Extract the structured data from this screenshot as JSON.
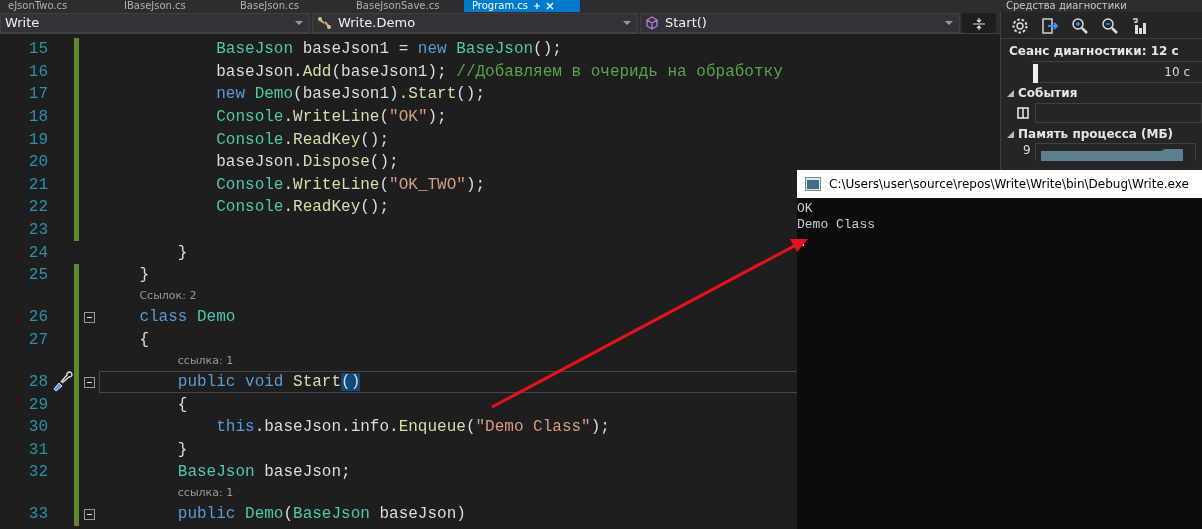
{
  "editor_tabs": [
    {
      "label": "eJsonTwo.cs",
      "selected": false
    },
    {
      "label": "IBaseJson.cs",
      "selected": false
    },
    {
      "label": "BaseJson.cs",
      "selected": false
    },
    {
      "label": "BaseJsonSave.cs",
      "selected": false
    },
    {
      "label": "Program.cs",
      "selected": true
    }
  ],
  "diagnostics_title": "Средства диагностики",
  "navigation": {
    "project": "Write",
    "type": "Write.Demo",
    "member": "Start()"
  },
  "code_lines": [
    {
      "kind": "statement",
      "number": "15",
      "changed": true,
      "foldable": false,
      "current": false,
      "quick_actions": false,
      "tokens": [
        {
          "kind": "t",
          "text": "BaseJson"
        },
        {
          "kind": "p",
          "text": " baseJson1 = "
        },
        {
          "kind": "k",
          "text": "new "
        },
        {
          "kind": "t",
          "text": "BaseJson"
        },
        {
          "kind": "p",
          "text": "();"
        }
      ]
    },
    {
      "kind": "statement",
      "number": "16",
      "changed": true,
      "foldable": false,
      "current": false,
      "quick_actions": false,
      "tokens": [
        {
          "kind": "p",
          "text": "baseJson."
        },
        {
          "kind": "m",
          "text": "Add"
        },
        {
          "kind": "p",
          "text": "(baseJson1); "
        },
        {
          "kind": "c",
          "text": "//Добавляем в очеридь на обработку"
        }
      ]
    },
    {
      "kind": "statement",
      "number": "17",
      "changed": true,
      "foldable": false,
      "current": false,
      "quick_actions": false,
      "tokens": [
        {
          "kind": "k",
          "text": "new "
        },
        {
          "kind": "t",
          "text": "Demo"
        },
        {
          "kind": "p",
          "text": "(baseJson1)."
        },
        {
          "kind": "m",
          "text": "Start"
        },
        {
          "kind": "p",
          "text": "();"
        }
      ]
    },
    {
      "kind": "statement",
      "number": "18",
      "changed": true,
      "foldable": false,
      "current": false,
      "quick_actions": false,
      "tokens": [
        {
          "kind": "t",
          "text": "Console"
        },
        {
          "kind": "p",
          "text": "."
        },
        {
          "kind": "m",
          "text": "WriteLine"
        },
        {
          "kind": "p",
          "text": "("
        },
        {
          "kind": "s",
          "text": "\"OK\""
        },
        {
          "kind": "p",
          "text": ");"
        }
      ]
    },
    {
      "kind": "statement",
      "number": "19",
      "changed": true,
      "foldable": false,
      "current": false,
      "quick_actions": false,
      "tokens": [
        {
          "kind": "t",
          "text": "Console"
        },
        {
          "kind": "p",
          "text": "."
        },
        {
          "kind": "m",
          "text": "ReadKey"
        },
        {
          "kind": "p",
          "text": "();"
        }
      ]
    },
    {
      "kind": "statement",
      "number": "20",
      "changed": true,
      "foldable": false,
      "current": false,
      "quick_actions": false,
      "tokens": [
        {
          "kind": "p",
          "text": "baseJson."
        },
        {
          "kind": "m",
          "text": "Dispose"
        },
        {
          "kind": "p",
          "text": "();"
        }
      ]
    },
    {
      "kind": "statement",
      "number": "21",
      "changed": true,
      "foldable": false,
      "current": false,
      "quick_actions": false,
      "tokens": [
        {
          "kind": "t",
          "text": "Console"
        },
        {
          "kind": "p",
          "text": "."
        },
        {
          "kind": "m",
          "text": "WriteLine"
        },
        {
          "kind": "p",
          "text": "("
        },
        {
          "kind": "s",
          "text": "\"OK_TWO\""
        },
        {
          "kind": "p",
          "text": ");"
        }
      ]
    },
    {
      "kind": "statement",
      "number": "22",
      "changed": true,
      "foldable": false,
      "current": false,
      "quick_actions": false,
      "tokens": [
        {
          "kind": "t",
          "text": "Console"
        },
        {
          "kind": "p",
          "text": "."
        },
        {
          "kind": "m",
          "text": "ReadKey"
        },
        {
          "kind": "p",
          "text": "();"
        }
      ]
    },
    {
      "kind": "blank",
      "number": "23",
      "changed": true,
      "foldable": false,
      "current": false,
      "quick_actions": false
    },
    {
      "kind": "member",
      "number": "24",
      "changed": false,
      "foldable": false,
      "current": false,
      "quick_actions": false,
      "tokens": [
        {
          "kind": "p",
          "text": "}"
        }
      ]
    },
    {
      "kind": "class",
      "number": "25",
      "changed": true,
      "foldable": false,
      "current": false,
      "quick_actions": false,
      "tokens": [
        {
          "kind": "p",
          "text": "}"
        }
      ]
    },
    {
      "kind": "classlens",
      "changed": true,
      "text": "Ссылок: 2"
    },
    {
      "kind": "class",
      "number": "26",
      "changed": true,
      "foldable": true,
      "current": false,
      "quick_actions": false,
      "tokens": [
        {
          "kind": "k",
          "text": "class "
        },
        {
          "kind": "t",
          "text": "Demo"
        }
      ]
    },
    {
      "kind": "class",
      "number": "27",
      "changed": true,
      "foldable": false,
      "current": false,
      "quick_actions": false,
      "tokens": [
        {
          "kind": "p",
          "text": "{"
        }
      ]
    },
    {
      "kind": "memberlens",
      "changed": true,
      "text": "ссылка: 1"
    },
    {
      "kind": "member",
      "number": "28",
      "changed": true,
      "foldable": true,
      "current": true,
      "quick_actions": true,
      "tokens": [
        {
          "kind": "k",
          "text": "public void "
        },
        {
          "kind": "m",
          "text": "Start"
        },
        {
          "kind": "match",
          "text": "()"
        }
      ]
    },
    {
      "kind": "member",
      "number": "29",
      "changed": true,
      "foldable": false,
      "current": false,
      "quick_actions": false,
      "tokens": [
        {
          "kind": "p",
          "text": "{"
        }
      ]
    },
    {
      "kind": "statement",
      "number": "30",
      "changed": true,
      "foldable": false,
      "current": false,
      "quick_actions": false,
      "tokens": [
        {
          "kind": "k",
          "text": "this"
        },
        {
          "kind": "p",
          "text": ".baseJson.info."
        },
        {
          "kind": "m",
          "text": "Enqueue"
        },
        {
          "kind": "p",
          "text": "("
        },
        {
          "kind": "s",
          "text": "\"Demo Class\""
        },
        {
          "kind": "p",
          "text": ");"
        }
      ]
    },
    {
      "kind": "member",
      "number": "31",
      "changed": true,
      "foldable": false,
      "current": false,
      "quick_actions": false,
      "tokens": [
        {
          "kind": "p",
          "text": "}"
        }
      ]
    },
    {
      "kind": "member",
      "number": "32",
      "changed": true,
      "foldable": false,
      "current": false,
      "quick_actions": false,
      "tokens": [
        {
          "kind": "t",
          "text": "BaseJson"
        },
        {
          "kind": "p",
          "text": " baseJson;"
        }
      ]
    },
    {
      "kind": "memberlens",
      "changed": true,
      "text": "ссылка: 1"
    },
    {
      "kind": "member",
      "number": "33",
      "changed": true,
      "foldable": true,
      "current": false,
      "quick_actions": false,
      "tokens": [
        {
          "kind": "k",
          "text": "public "
        },
        {
          "kind": "t",
          "text": "Demo"
        },
        {
          "kind": "p",
          "text": "("
        },
        {
          "kind": "t",
          "text": "BaseJson"
        },
        {
          "kind": "p",
          "text": " baseJson)"
        }
      ]
    }
  ],
  "diagnostics": {
    "session": "Сеанс диагностики: 12 с",
    "tick": "10 с",
    "events_title": "События",
    "memory_title": "Память процесса (МБ)",
    "memory_max": "9"
  },
  "console": {
    "title": "C:\\Users\\user\\source\\repos\\Write\\Write\\bin\\Debug\\Write.exe",
    "output": [
      "OK",
      "Demo Class"
    ]
  }
}
